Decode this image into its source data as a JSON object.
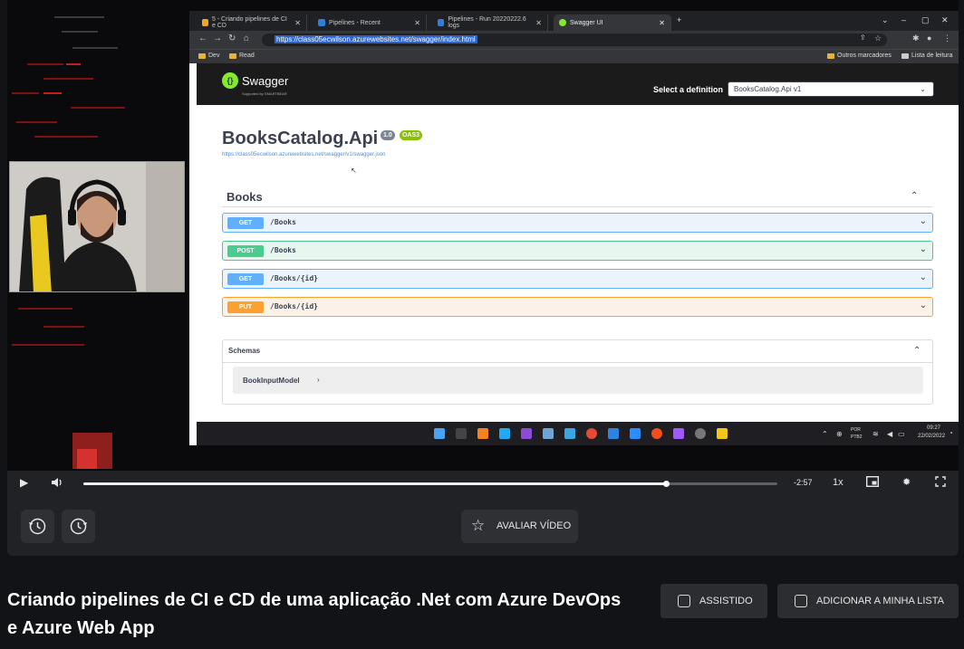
{
  "browser": {
    "tabs": [
      {
        "label": "5 - Criando pipelines de CI e CD"
      },
      {
        "label": "Pipelines - Recent"
      },
      {
        "label": "Pipelines - Run 20220222.6 logs"
      },
      {
        "label": "Swagger UI"
      }
    ],
    "url": "https://class05ecwilson.azurewebsites.net/swagger/index.html",
    "bookmarks": {
      "dev": "Dev",
      "read": "Read",
      "other": "Outros marcadores",
      "reading_list": "Lista de leitura"
    }
  },
  "swagger": {
    "logo_text": "Swagger",
    "logo_sub": "Supported by SMARTBEAR",
    "definition_label": "Select a definition",
    "definition_value": "BooksCatalog.Api v1",
    "api_title": "BooksCatalog.Api",
    "version_badge": "1.0",
    "oas_badge": "OAS3",
    "spec_url": "https://class05ecwilson.azurewebsites.net/swagger/v1/swagger.json",
    "section": "Books",
    "operations": [
      {
        "method": "GET",
        "path": "/Books"
      },
      {
        "method": "POST",
        "path": "/Books"
      },
      {
        "method": "GET",
        "path": "/Books/{id}"
      },
      {
        "method": "PUT",
        "path": "/Books/{id}"
      }
    ],
    "schemas_title": "Schemas",
    "schema_model": "BookInputModel"
  },
  "taskbar": {
    "lang": "POR",
    "layout": "PTB2",
    "time": "09:27",
    "date": "22/02/2022"
  },
  "player": {
    "progress": 0.84,
    "time_remaining": "-2:57",
    "speed": "1x",
    "rate_label": "AVALIAR VÍDEO"
  },
  "video_title": "Criando pipelines de CI e CD de uma aplicação .Net com Azure DevOps e Azure Web App",
  "actions": {
    "watched": "ASSISTIDO",
    "add_list": "ADICIONAR A MINHA LISTA"
  },
  "colors": {
    "get": "#61affe",
    "post": "#49cc90",
    "put": "#fca130",
    "swagger_green": "#85ea2d"
  }
}
